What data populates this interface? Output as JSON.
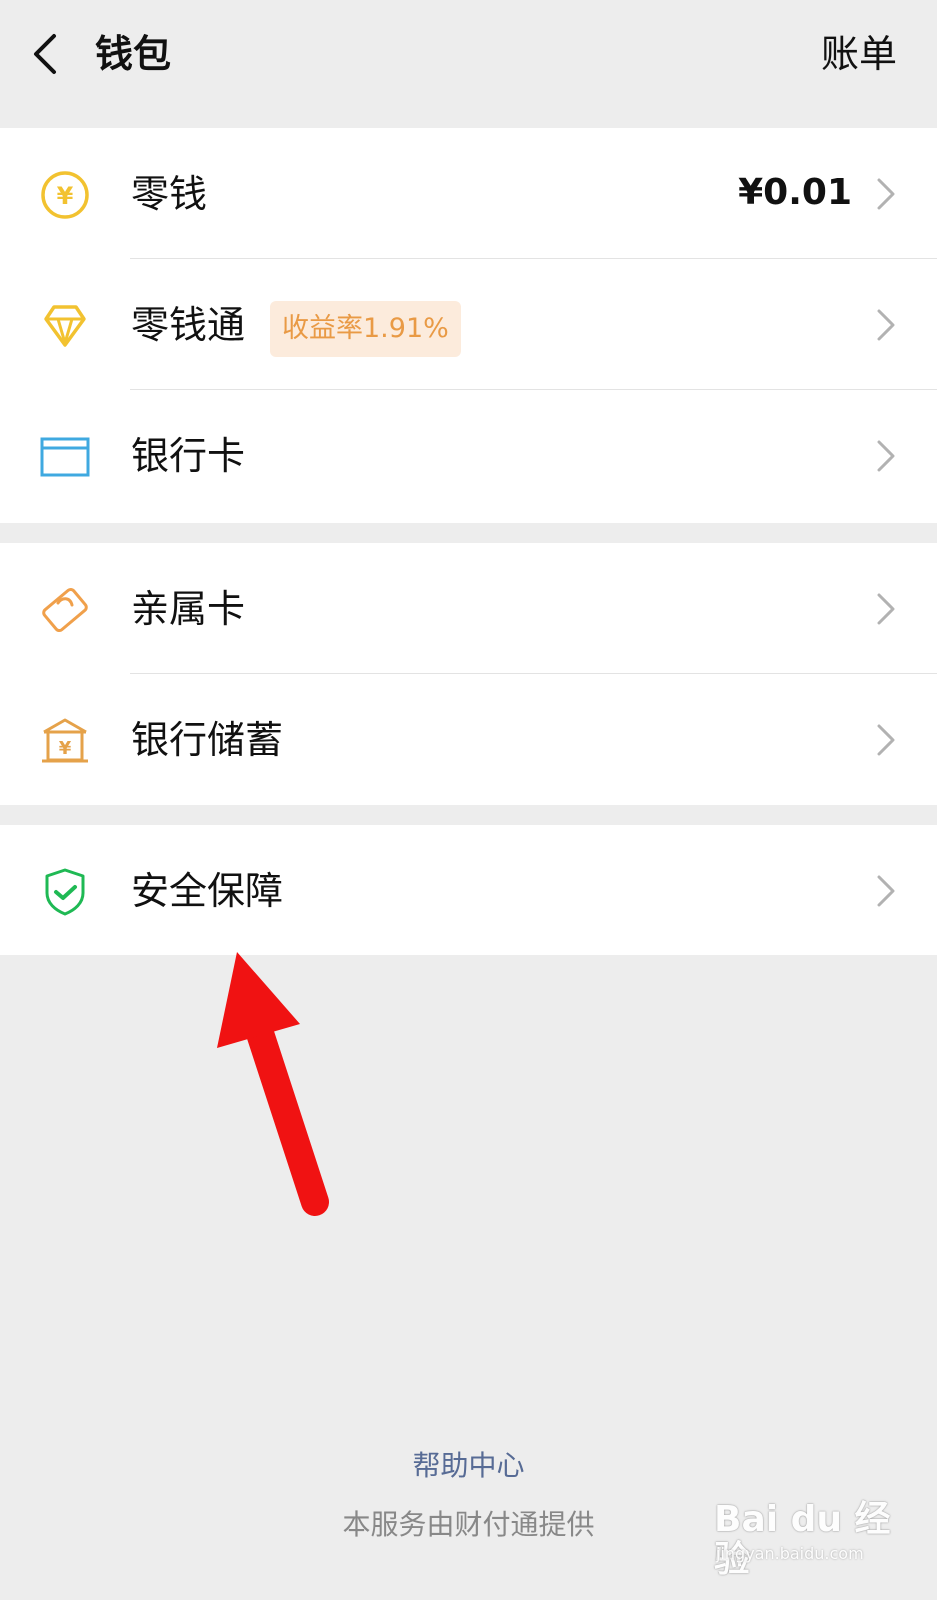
{
  "header": {
    "title": "钱包",
    "bill_label": "账单"
  },
  "groups": [
    {
      "items": [
        {
          "label": "零钱",
          "value": "¥0.01",
          "icon": "coin-icon"
        },
        {
          "label": "零钱通",
          "badge": "收益率1.91%",
          "icon": "diamond-icon"
        },
        {
          "label": "银行卡",
          "icon": "bank-card-icon"
        }
      ]
    },
    {
      "items": [
        {
          "label": "亲属卡",
          "icon": "family-card-icon"
        },
        {
          "label": "银行储蓄",
          "icon": "bank-savings-icon"
        }
      ]
    },
    {
      "items": [
        {
          "label": "安全保障",
          "icon": "shield-check-icon"
        }
      ]
    }
  ],
  "footer": {
    "help_label": "帮助中心",
    "provider_note": "本服务由财付通提供"
  },
  "watermark": {
    "main": "Bai du 经验",
    "sub": "jingyan.baidu.com"
  },
  "colors": {
    "coin": "#f2c230",
    "diamond": "#f2c230",
    "card": "#3fa9e0",
    "family": "#f0a04b",
    "savings": "#e5a24a",
    "shield": "#1fb954",
    "arrow": "#f01212",
    "help_link": "#576b95"
  }
}
